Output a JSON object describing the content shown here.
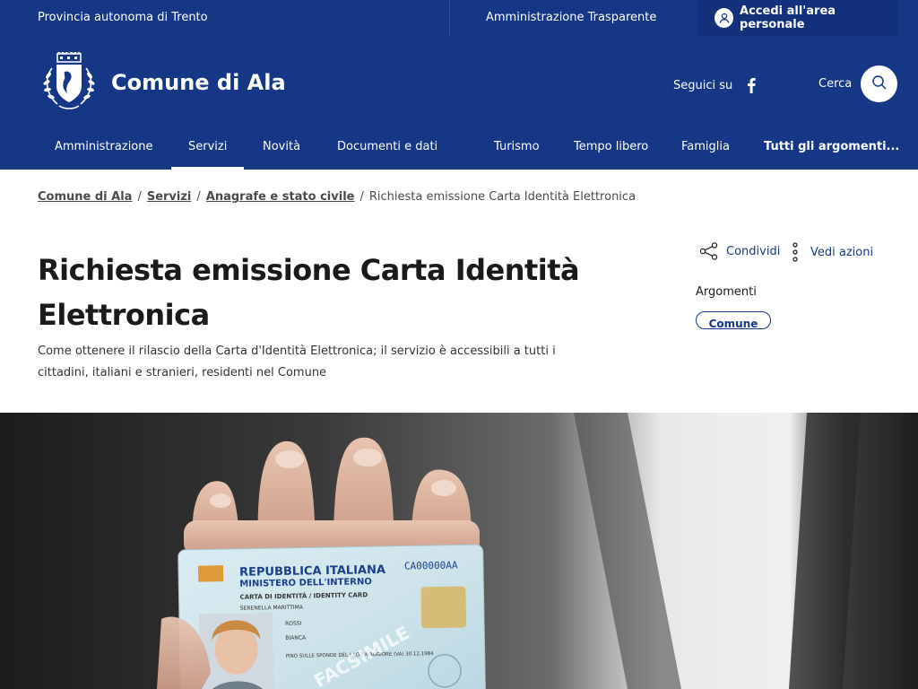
{
  "topbar": {
    "province": "Provincia autonoma di Trento",
    "transparency": "Amministrazione Trasparente",
    "login": "Accedi all'area personale"
  },
  "header": {
    "brand": "Comune di Ala",
    "social_label": "Seguici su",
    "search_label": "Cerca"
  },
  "nav": {
    "items": [
      "Amministrazione",
      "Servizi",
      "Novità",
      "Documenti e dati",
      "Turismo",
      "Tempo libero",
      "Famiglia",
      "Tutti gli argomenti..."
    ]
  },
  "breadcrumb": {
    "items": [
      "Comune di Ala",
      "Servizi",
      "Anagrafe e stato civile"
    ],
    "current": "Richiesta emissione Carta Identità Elettronica",
    "separator": "/"
  },
  "page": {
    "title_line1": "Richiesta emissione Carta Identità",
    "title_line2": "Elettronica",
    "description": "Come ottenere il rilascio della Carta d'Identità Elettronica; il servizio è accessibili a tutti i cittadini, italiani e stranieri, residenti nel Comune"
  },
  "sidebar": {
    "share": "Condividi",
    "actions": "Vedi azioni",
    "topics_label": "Argomenti",
    "topic_chip": "Comune"
  },
  "card": {
    "country": "REPUBBLICA ITALIANA",
    "ministry": "MINISTERO DELL'INTERNO",
    "number": "CA00000AA",
    "doc_type": "CARTA DI IDENTITÀ / IDENTITY CARD",
    "municipality": "SERENELLA MARITTIMA",
    "surname": "ROSSI",
    "name": "BIANCA",
    "birthplace": "PINO SULLE SPONDE DEL LAGO MAGGIORE (VA) 30.12.1984",
    "watermark": "FACSIMILE"
  },
  "colors": {
    "primary": "#163786",
    "primary_dark": "#13307a",
    "text": "#1a1a1a"
  },
  "icons": {
    "login": "user-icon",
    "facebook": "facebook-icon",
    "search": "search-icon",
    "share": "share-icon",
    "actions": "more-vertical-icon"
  }
}
